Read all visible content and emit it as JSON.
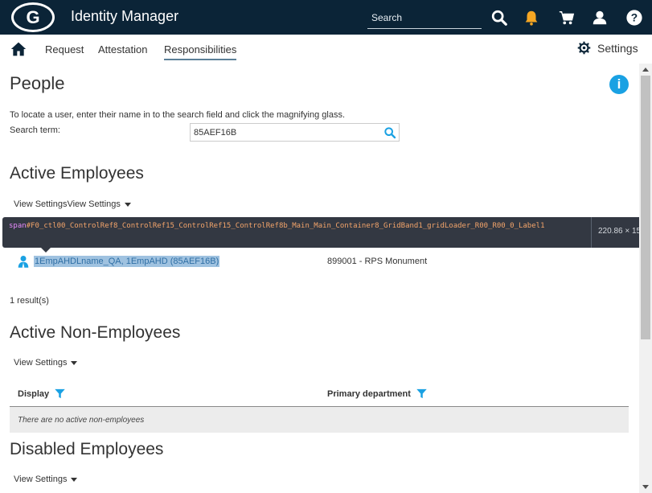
{
  "header": {
    "logo_text": "G",
    "app_title": "Identity Manager",
    "search_placeholder": "Search",
    "icons": [
      "search-icon",
      "bell-icon",
      "cart-icon",
      "user-icon",
      "help-icon"
    ],
    "bell_color": "#f5a623"
  },
  "nav": {
    "home_icon": "home-icon",
    "tabs": [
      {
        "label": "Request",
        "active": false
      },
      {
        "label": "Attestation",
        "active": false
      },
      {
        "label": "Responsibilities",
        "active": true
      }
    ],
    "settings_label": "Settings",
    "settings_icon": "gear-icon"
  },
  "page": {
    "title": "People",
    "info_icon": "i",
    "helper_text": "To locate a user, enter their name in to the search field and click the magnifying glass.",
    "search_label": "Search term:",
    "search_value": "85AEF16B"
  },
  "active_employees": {
    "title": "Active Employees",
    "view_settings_label": "View Settings",
    "view_settings_button": "View Settings",
    "rows": [
      {
        "name": "1EmpAHDLname_QA, 1EmpAHD (85AEF16B)",
        "department": "899001 - RPS Monument"
      }
    ],
    "results_text": "1 result(s)"
  },
  "inspector_tooltip": {
    "tag": "span",
    "selector": "#F0_ctl00_ControlRef8_ControlRef15_ControlRef15_ControlRef8b_Main_Main_Container8_GridBand1_gridLoader_R00_R00_0_Label1",
    "dimensions": "220.86 × 15"
  },
  "active_non_employees": {
    "title": "Active Non-Employees",
    "view_settings_label": "View Settings",
    "columns": [
      {
        "label": "Display"
      },
      {
        "label": "Primary department"
      }
    ],
    "empty_message": "There are no active non-employees",
    "accent_color": "#1aa1e3"
  },
  "disabled_employees": {
    "title": "Disabled Employees",
    "view_settings_label": "View Settings"
  }
}
